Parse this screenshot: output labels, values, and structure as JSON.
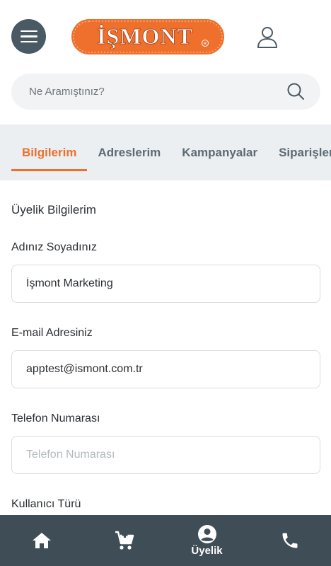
{
  "header": {
    "logo_text": "İŞMONT",
    "brand_color": "#ef6f2c"
  },
  "search": {
    "placeholder": "Ne Aramıştınız?"
  },
  "tabs": [
    {
      "label": "Bilgilerim",
      "active": true
    },
    {
      "label": "Adreslerim",
      "active": false
    },
    {
      "label": "Kampanyalar",
      "active": false
    },
    {
      "label": "Siparişlerim",
      "active": false
    }
  ],
  "form": {
    "title": "Üyelik Bilgilerim",
    "name_label": "Adınız Soyadınız",
    "name_value": "İşmont Marketing",
    "email_label": "E-mail Adresiniz",
    "email_value": "apptest@ismont.com.tr",
    "phone_label": "Telefon Numarası",
    "phone_placeholder": "Telefon Numarası",
    "phone_value": "",
    "user_type_label": "Kullanıcı Türü"
  },
  "bottom_nav": {
    "items": [
      {
        "icon": "home-icon",
        "label": ""
      },
      {
        "icon": "cart-icon",
        "label": ""
      },
      {
        "icon": "account-icon",
        "label": "Üyelik",
        "active": true
      },
      {
        "icon": "phone-icon",
        "label": ""
      }
    ]
  },
  "colors": {
    "accent": "#ef6f2c",
    "nav_bg": "#3f4d56",
    "menu_btn_bg": "#4a5a65",
    "tabs_bg": "#eceff1"
  }
}
